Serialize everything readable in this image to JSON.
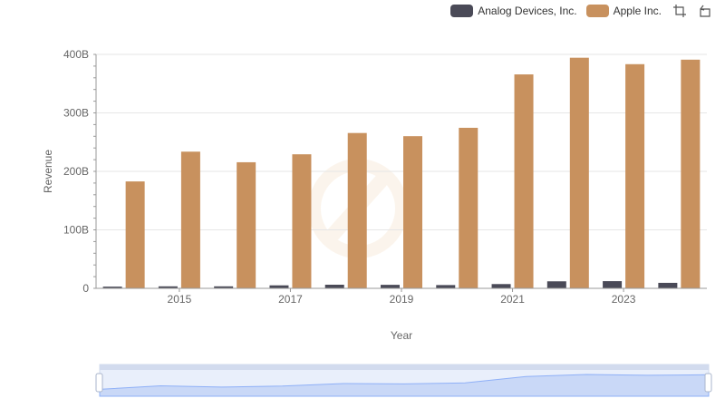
{
  "chart_data": {
    "type": "bar",
    "x": [
      "2014",
      "2015",
      "2016",
      "2017",
      "2018",
      "2019",
      "2020",
      "2021",
      "2022",
      "2023",
      "2024"
    ],
    "x_tick_labels": [
      "2015",
      "2017",
      "2019",
      "2021",
      "2023"
    ],
    "xlabel": "Year",
    "ylabel": "Revenue",
    "ylim": [
      0,
      400
    ],
    "y_tick_labels": [
      "0",
      "100B",
      "200B",
      "300B",
      "400B"
    ],
    "grid": true,
    "legend_position": "top-right",
    "series": [
      {
        "name": "Analog Devices, Inc.",
        "color": "#4a4a57",
        "values": [
          2.9,
          3.4,
          3.4,
          5.1,
          6.2,
          6.0,
          5.6,
          7.3,
          12.0,
          12.3,
          9.4
        ]
      },
      {
        "name": "Apple Inc.",
        "color": "#c8915e",
        "values": [
          182.8,
          233.7,
          215.6,
          229.2,
          265.6,
          260.2,
          274.5,
          365.8,
          394.3,
          383.3,
          391.0
        ]
      }
    ]
  },
  "toolbar": {
    "zoom_icon": "zoom-crop-icon",
    "restore_icon": "restore-icon"
  }
}
